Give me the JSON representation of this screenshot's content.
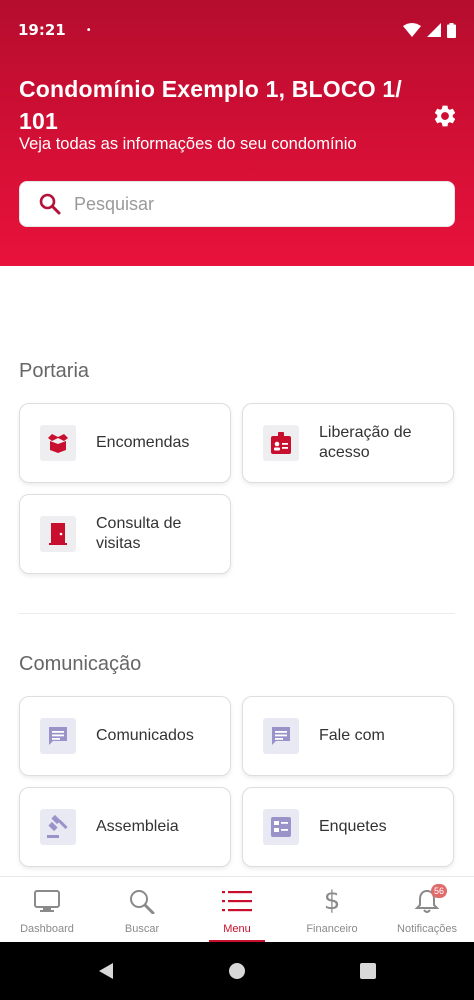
{
  "status_bar": {
    "time": "19:21",
    "dot": "•"
  },
  "header": {
    "title": "Condomínio Exemplo 1, BLOCO 1/ 101",
    "subtitle": "Veja todas as informações do seu condomínio"
  },
  "search": {
    "placeholder": "Pesquisar"
  },
  "sections": {
    "portaria": {
      "title": "Portaria",
      "items": [
        {
          "label": "Encomendas",
          "icon": "package-icon"
        },
        {
          "label": "Liberação de acesso",
          "icon": "id-badge-icon"
        },
        {
          "label": "Consulta de visitas",
          "icon": "door-icon"
        }
      ]
    },
    "comunicacao": {
      "title": "Comunicação",
      "items": [
        {
          "label": "Comunicados",
          "icon": "message-icon"
        },
        {
          "label": "Fale com",
          "icon": "message-icon"
        },
        {
          "label": "Assembleia",
          "icon": "gavel-icon"
        },
        {
          "label": "Enquetes",
          "icon": "poll-icon"
        }
      ]
    }
  },
  "bottom_nav": {
    "items": [
      {
        "label": "Dashboard",
        "icon": "monitor-icon"
      },
      {
        "label": "Buscar",
        "icon": "search-icon"
      },
      {
        "label": "Menu",
        "icon": "list-icon",
        "active": true
      },
      {
        "label": "Financeiro",
        "icon": "dollar-icon"
      },
      {
        "label": "Notificações",
        "icon": "bell-icon",
        "badge": "56"
      }
    ]
  },
  "colors": {
    "brand": "#c8102e",
    "header_top": "#b50d2e",
    "header_bottom": "#e8123c",
    "purple_icon": "#9a93c9"
  }
}
